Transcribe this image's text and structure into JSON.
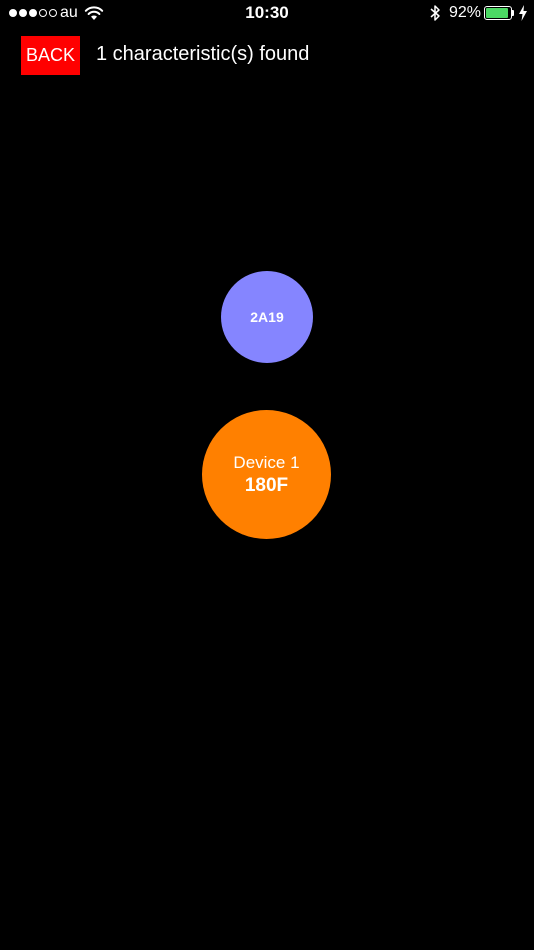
{
  "status_bar": {
    "carrier": "au",
    "time": "10:30",
    "battery_percent": "92%",
    "battery_level": 0.92,
    "signal_bars_filled": 3,
    "signal_bars_total": 5,
    "battery_color": "#4cd964"
  },
  "header": {
    "back_label": "BACK",
    "title": "1 characteristic(s) found",
    "back_color": "#ff0000"
  },
  "characteristic": {
    "uuid": "2A19",
    "color": "#8585ff"
  },
  "device": {
    "name": "Device 1",
    "service_uuid": "180F",
    "color": "#ff8000"
  },
  "icons": [
    "signal-icon",
    "wifi-icon",
    "bluetooth-icon",
    "battery-icon",
    "charging-icon"
  ]
}
